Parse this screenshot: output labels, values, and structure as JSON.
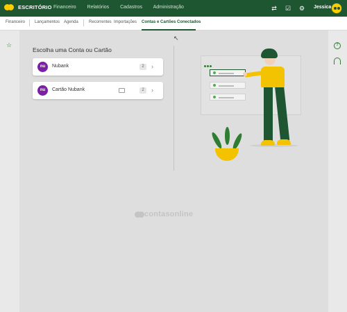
{
  "brand": "ESCRITÓRIO",
  "topnav": [
    "Financeiro",
    "Relatórios",
    "Cadastros",
    "Administração"
  ],
  "user": {
    "name": "Jessica"
  },
  "subnav": {
    "root": "Financeiro",
    "items": [
      "Lançamentos",
      "Agenda",
      "Recorrentes",
      "Importações",
      "Contas e Cartões Conectados"
    ]
  },
  "main": {
    "heading": "Escolha uma Conta ou Cartão",
    "accounts": [
      {
        "logo": "nu",
        "label": "Nubank",
        "count": "2"
      },
      {
        "logo": "nu",
        "label": "Cartão Nubank",
        "count": "2"
      }
    ]
  },
  "watermark": "contasonline",
  "colors": {
    "primary": "#1e5631",
    "accent": "#ffcc00",
    "nubank": "#7d1ea8"
  },
  "icons": [
    "transfer-icon",
    "tasks-icon",
    "settings-icon",
    "expand-icon",
    "star-icon",
    "help-icon",
    "headset-icon",
    "card-icon",
    "chevron-right-icon"
  ]
}
